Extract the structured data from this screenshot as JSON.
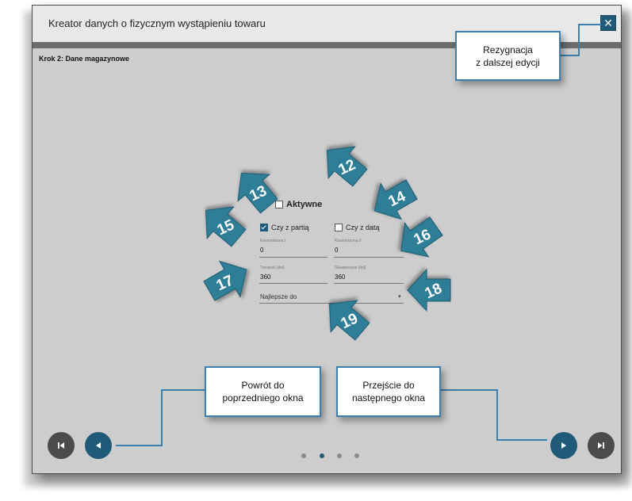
{
  "window": {
    "title": "Kreator danych o fizycznym wystąpieniu towaru",
    "close_label": "✕",
    "step_label": "Krok 2: Dane magazynowe"
  },
  "form": {
    "active_label": "Aktywne",
    "batch_label": "Czy z partią",
    "date_label": "Czy z datą",
    "quarantine1_label": "Kwarantanna I",
    "quarantine1_value": "0",
    "quarantine2_label": "Kwarantanna II",
    "quarantine2_value": "0",
    "durability_label": "Trwałość  [dni]",
    "durability_value": "360",
    "storage_label": "Składowanie [dni]",
    "storage_value": "360",
    "best_before_label": "Najlepsze do"
  },
  "callouts": {
    "cancel_line1": "Rezygnacja",
    "cancel_line2": "z dalszej edycji",
    "back_line1": "Powrót do",
    "back_line2": "poprzedniego okna",
    "next_line1": "Przejście do",
    "next_line2": "następnego okna"
  },
  "badges": [
    "12",
    "13",
    "14",
    "15",
    "16",
    "17",
    "18",
    "19"
  ],
  "pagination": {
    "total": 4,
    "active_index": 1
  },
  "colors": {
    "accent": "#1f5a78",
    "badge": "#2f7e98",
    "callout_border": "#3a7fb0"
  },
  "icons": {
    "first": "skip-first-icon",
    "prev": "play-left-icon",
    "next": "play-right-icon",
    "last": "skip-last-icon",
    "close": "close-icon"
  }
}
